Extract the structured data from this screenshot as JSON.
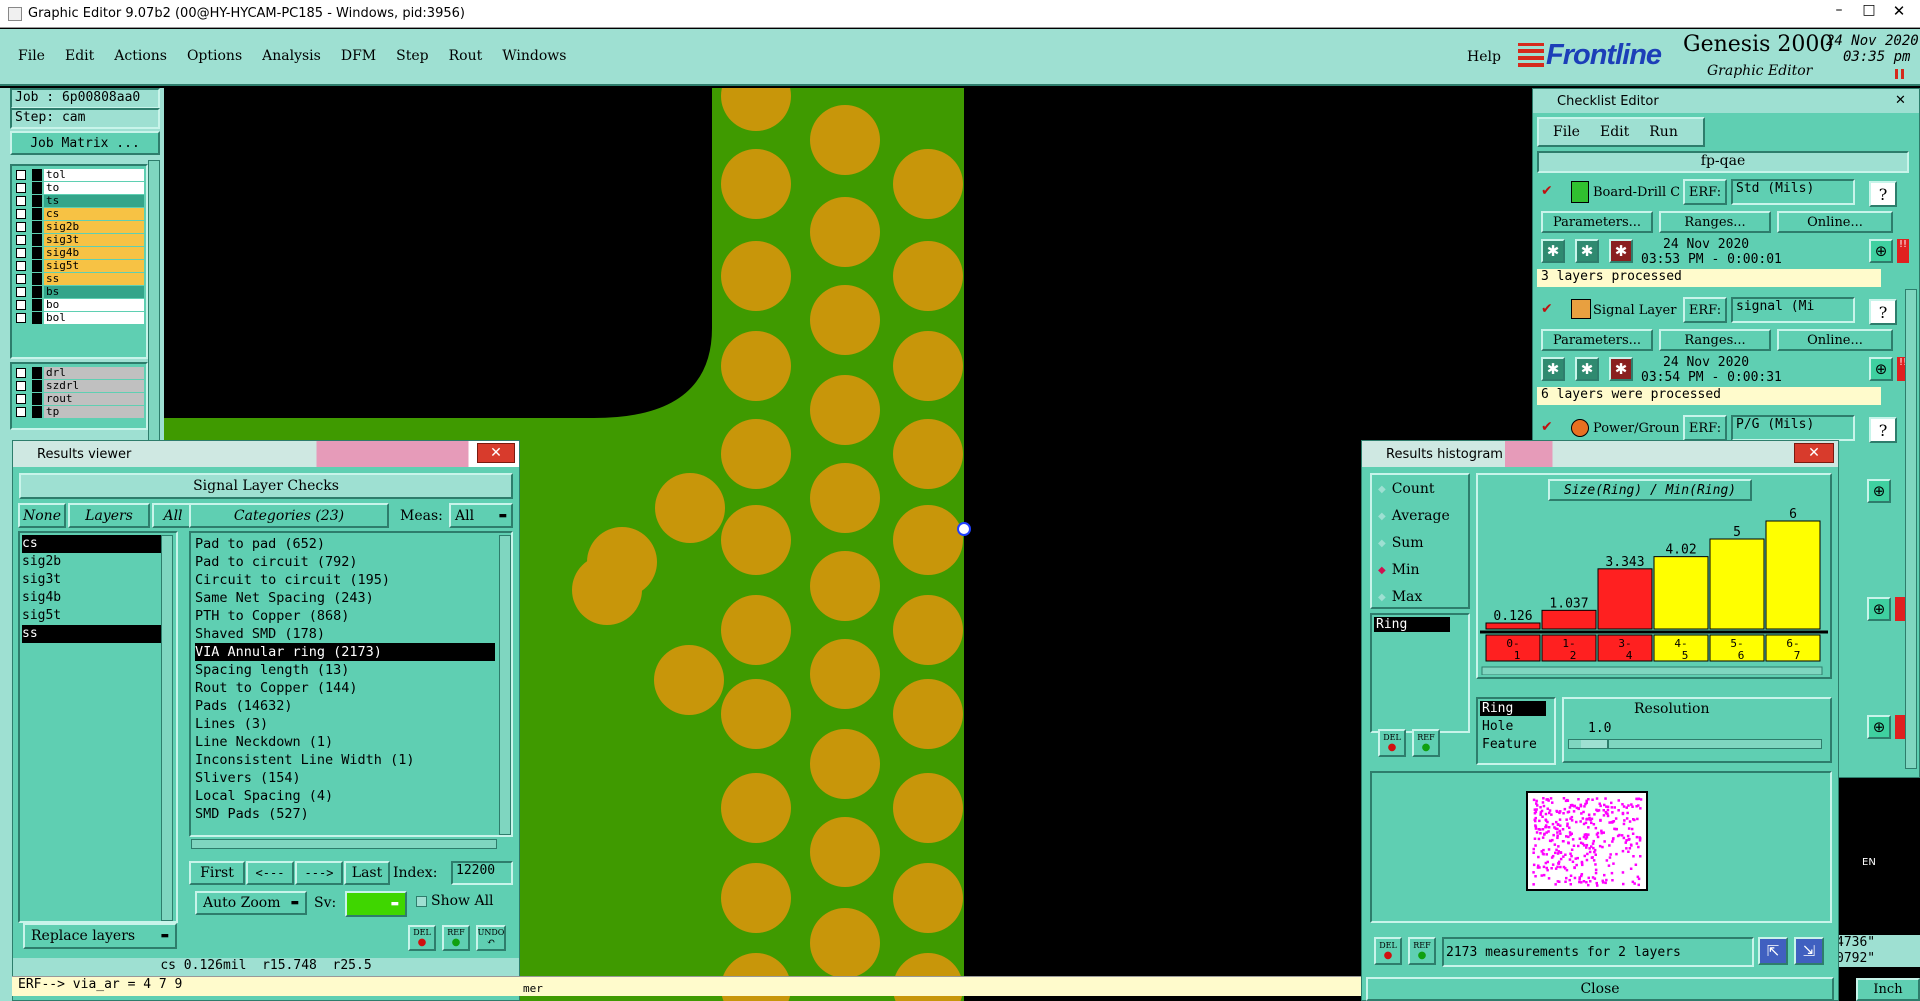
{
  "window": {
    "title": "Graphic Editor 9.07b2 (00@HY-HYCAM-PC185 - Windows, pid:3956)"
  },
  "menu": {
    "items": [
      "File",
      "Edit",
      "Actions",
      "Options",
      "Analysis",
      "DFM",
      "Step",
      "Rout",
      "Windows"
    ],
    "help": "Help"
  },
  "branding": {
    "logo": "Frontline",
    "product": "Genesis 2000",
    "subtitle": "Graphic Editor",
    "date": "24 Nov 2020",
    "time": "03:35 pm"
  },
  "job": {
    "job_label": "Job : 6p00808aa0",
    "step_label": "Step: cam",
    "matrix_button": "Job Matrix ..."
  },
  "layers": [
    {
      "name": "tol",
      "color": "#ffffff"
    },
    {
      "name": "to",
      "color": "#ffffff"
    },
    {
      "name": "ts",
      "color": "#34a58a"
    },
    {
      "name": "cs",
      "color": "#f7c244"
    },
    {
      "name": "sig2b",
      "color": "#f7c244"
    },
    {
      "name": "sig3t",
      "color": "#f7c244"
    },
    {
      "name": "sig4b",
      "color": "#f7c244"
    },
    {
      "name": "sig5t",
      "color": "#f7c244"
    },
    {
      "name": "ss",
      "color": "#f7c244"
    },
    {
      "name": "bs",
      "color": "#34a58a"
    },
    {
      "name": "bo",
      "color": "#ffffff"
    },
    {
      "name": "bol",
      "color": "#ffffff"
    }
  ],
  "layers2": [
    {
      "name": "drl",
      "color": "#c0c0c0"
    },
    {
      "name": "szdrl",
      "color": "#c0c0c0"
    },
    {
      "name": "rout",
      "color": "#c0c0c0"
    },
    {
      "name": "tp",
      "color": "#c0c0c0"
    }
  ],
  "results_viewer": {
    "title": "Results viewer",
    "header": "Signal Layer Checks",
    "none_btn": "None",
    "layers_btn": "Layers",
    "all_btn": "All",
    "categories_label": "Categories (23)",
    "meas_label": "Meas:",
    "meas_value": "All",
    "layer_list": [
      "cs",
      "sig2b",
      "sig3t",
      "sig4b",
      "sig5t",
      "ss"
    ],
    "categories": [
      "Pad to pad (652)",
      "Pad to circuit (792)",
      "Circuit to circuit (195)",
      "Same Net Spacing (243)",
      "PTH to Copper (868)",
      "Shaved SMD (178)",
      "VIA Annular ring (2173)",
      "Spacing length (13)",
      "Rout to Copper (144)",
      "Pads (14632)",
      "Lines (3)",
      "Line Neckdown (1)",
      "Inconsistent Line Width (1)",
      "Slivers (154)",
      "Local Spacing (4)",
      "SMD Pads (527)"
    ],
    "first_btn": "First",
    "prev_btn": "<---",
    "next_btn": "--->",
    "last_btn": "Last",
    "index_label": "Index:",
    "index_value": "12200",
    "autozoom": "Auto Zoom",
    "sv_label": "Sv:",
    "show_all": "Show All",
    "replace_layers": "Replace layers",
    "del_btn": "DEL",
    "ref_btn": "REF",
    "undo_btn": "UNDO",
    "status": "cs 0.126mil  r15.748  r25.5",
    "erf_line": "ERF--> via_ar = 4 7 9"
  },
  "checklist": {
    "title": "Checklist Editor",
    "menu": [
      "File",
      "Edit",
      "Run"
    ],
    "name": "fp-qae",
    "checks": [
      {
        "name": "Board-Drill Che",
        "erf": "ERF:",
        "erf_value": "Std (Mils)",
        "params": "Parameters...",
        "ranges": "Ranges...",
        "online": "Online...",
        "date": "24 Nov 2020",
        "time": "03:53 PM - 0:00:01",
        "status": "3 layers processed"
      },
      {
        "name": "Signal Layer Ch",
        "erf": "ERF:",
        "erf_value": "signal (Mi",
        "params": "Parameters...",
        "ranges": "Ranges...",
        "online": "Online...",
        "date": "24 Nov 2020",
        "time": "03:54 PM - 0:00:31",
        "status": "6 layers were processed"
      },
      {
        "name": "Power/Ground C",
        "erf": "ERF:",
        "erf_value": "P/G (Mils)"
      }
    ]
  },
  "histogram": {
    "title": "Results histogram",
    "modes": [
      "Count",
      "Average",
      "Sum",
      "Min",
      "Max"
    ],
    "selected_mode": "Min",
    "list_item": "Ring",
    "chart_title": "Size(Ring) / Min(Ring)",
    "resolution_label": "Resolution",
    "resolution_value": "1.0",
    "types": [
      "Ring",
      "Hole",
      "Feature"
    ],
    "summary": "2173 measurements for 2 layers",
    "close": "Close",
    "del_btn": "DEL",
    "ref_btn": "REF"
  },
  "chart_data": {
    "type": "bar",
    "title": "Size(Ring) / Min(Ring)",
    "categories": [
      "0-1",
      "1-2",
      "3-4",
      "4-5",
      "5-6",
      "6-7"
    ],
    "values": [
      0.126,
      1.037,
      3.343,
      4.02,
      5,
      6
    ],
    "colors": [
      "#ff2020",
      "#ff2020",
      "#ff2020",
      "#ffff00",
      "#ffff00",
      "#ffff00"
    ],
    "ylim": [
      0,
      6
    ]
  },
  "bottom_strip": {
    "partial_text": "mer",
    "coord1": "4736\"",
    "coord2": "0792\"",
    "unit": "Inch",
    "lang": "EN"
  },
  "colors": {
    "board_green": "#3f9a00",
    "pad_gold": "#c8960a",
    "panel_teal": "#5fcfb2",
    "title_teal": "#9ee0d2"
  }
}
